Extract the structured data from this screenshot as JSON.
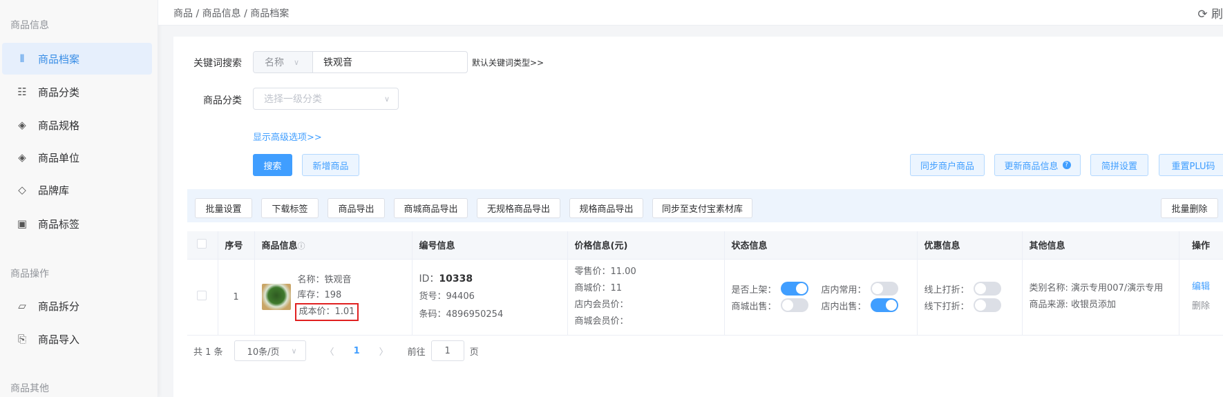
{
  "sidebar": {
    "sections": [
      "商品信息",
      "商品操作",
      "商品其他"
    ],
    "items": [
      {
        "label": "商品档案",
        "icon": "barcode-icon",
        "glyph": "⫴"
      },
      {
        "label": "商品分类",
        "icon": "list-icon",
        "glyph": "☷"
      },
      {
        "label": "商品规格",
        "icon": "layers-icon",
        "glyph": "◈"
      },
      {
        "label": "商品单位",
        "icon": "layers-icon",
        "glyph": "◈"
      },
      {
        "label": "品牌库",
        "icon": "tag-icon",
        "glyph": "◇"
      },
      {
        "label": "商品标签",
        "icon": "label-icon",
        "glyph": "▣"
      },
      {
        "label": "商品拆分",
        "icon": "split-icon",
        "glyph": "▱"
      },
      {
        "label": "商品导入",
        "icon": "import-icon",
        "glyph": "⎘"
      }
    ]
  },
  "header": {
    "breadcrumb": "商品 / 商品信息 / 商品档案",
    "refresh_glyph": "⟳ 刷"
  },
  "search": {
    "keyword_label": "关键词搜索",
    "keyword_type": "名称",
    "keyword_value": "铁观音",
    "default_type_link": "默认关键词类型>>",
    "category_label": "商品分类",
    "category_placeholder": "选择一级分类",
    "advanced_link": "显示高级选项>>",
    "search_btn": "搜索",
    "add_btn": "新增商品",
    "right_btns": [
      "同步商户商品",
      "更新商品信息",
      "简拼设置",
      "重置PLU码"
    ]
  },
  "toolbar": {
    "buttons": [
      "批量设置",
      "下载标签",
      "商品导出",
      "商城商品导出",
      "无规格商品导出",
      "规格商品导出",
      "同步至支付宝素材库"
    ],
    "batch_delete": "批量删除"
  },
  "table": {
    "headers": [
      "序号",
      "商品信息",
      "编号信息",
      "价格信息(元)",
      "状态信息",
      "优惠信息",
      "其他信息",
      "操作"
    ],
    "rows": [
      {
        "index": "1",
        "name": "名称：铁观音",
        "stock": "库存：198",
        "cost": "成本价：1.01",
        "id_label": "ID：",
        "id": "10338",
        "sku": "货号：94406",
        "barcode": "条码：4896950254",
        "retail": "零售价：11.00",
        "mall": "商城价：11",
        "store_member": "店内会员价：",
        "mall_member": "商城会员价：",
        "status": [
          {
            "label": "是否上架：",
            "on": true
          },
          {
            "label": "店内常用：",
            "on": false
          },
          {
            "label": "商城出售：",
            "on": false
          },
          {
            "label": "店内出售：",
            "on": true
          }
        ],
        "discount": [
          {
            "label": "线上打折：",
            "on": false
          },
          {
            "label": "线下打折：",
            "on": false
          }
        ],
        "category": "类别名称: 演示专用007/演示专用",
        "source": "商品来源: 收银员添加",
        "edit": "编辑",
        "delete": "删除"
      }
    ]
  },
  "pager": {
    "total": "共 1 条",
    "page_size": "10条/页",
    "current": "1",
    "goto_label": "前往",
    "goto_value": "1",
    "page_suffix": "页"
  }
}
